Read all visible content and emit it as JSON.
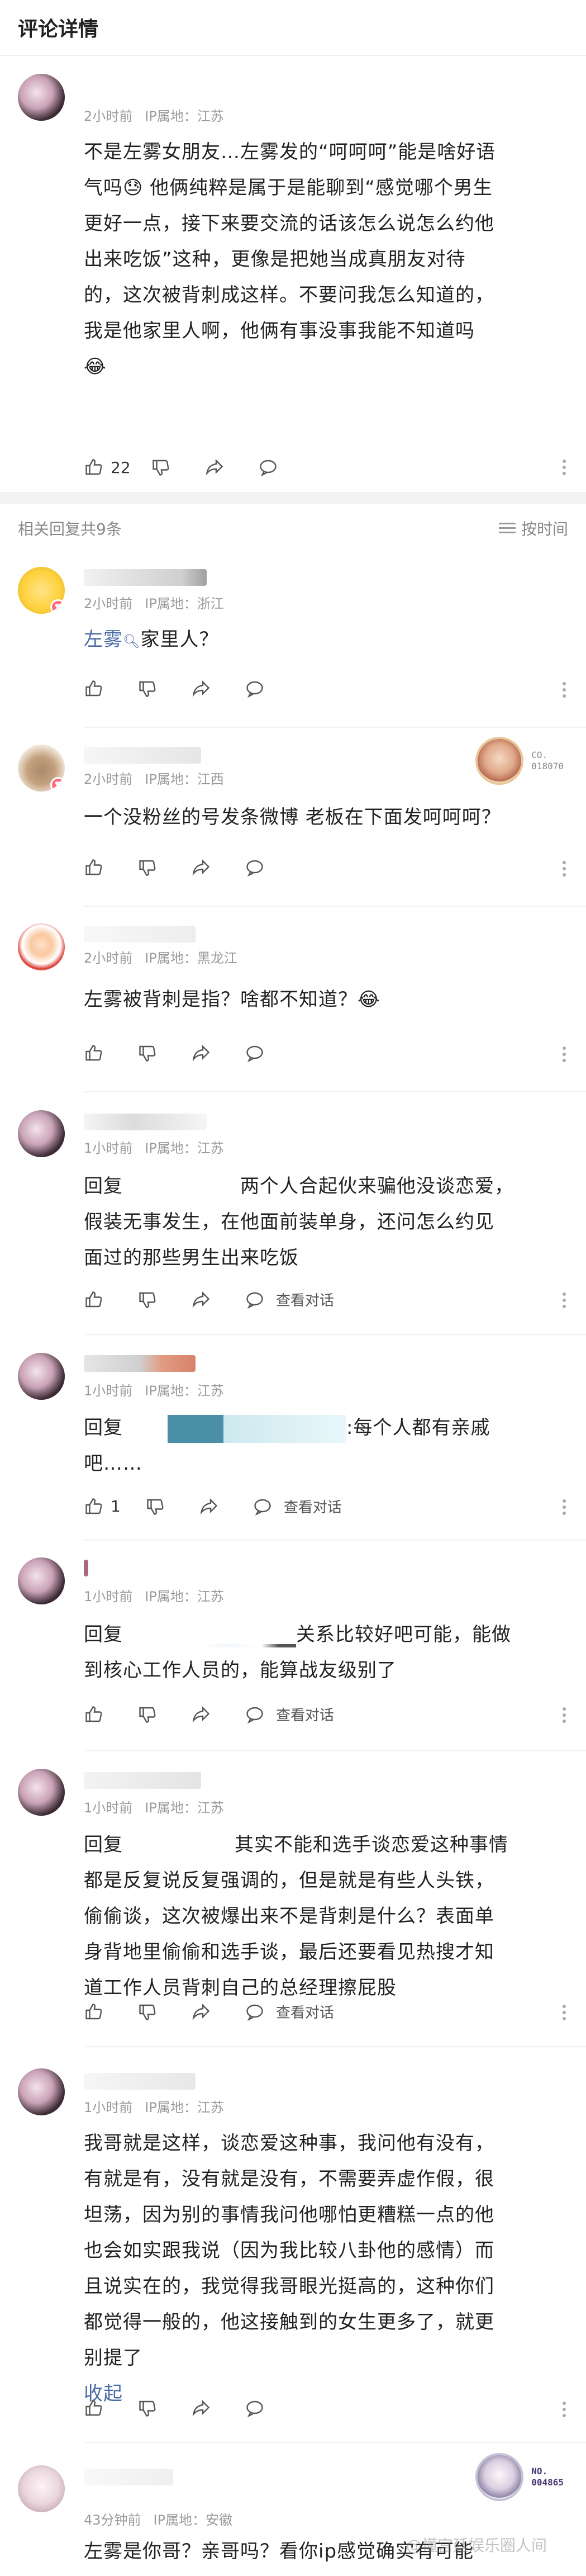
{
  "header": {
    "title": "评论详情"
  },
  "main_comment": {
    "time": "2小时前",
    "ip": "IP属地：江苏",
    "text_lines": [
      "不是左雾女朋友…左雾发的“呵呵呵”能是啥好语",
      "气吗😓 他俩纯粹是属于是能聊到“感觉哪个男生",
      "更好一点，接下来要交流的话该怎么说怎么约他",
      "出来吃饭”这种，更像是把她当成真朋友对待",
      "的，这次被背刺成这样。不要问我怎么知道的，",
      "我是他家里人啊，他俩有事没事我能不知道吗",
      "😂"
    ],
    "like_count": "22"
  },
  "replies_section": {
    "label": "相关回复共9条",
    "sort_label": "按时间"
  },
  "replies": [
    {
      "time": "2小时前",
      "ip": "IP属地：浙江",
      "link": "左雾",
      "text": "家里人？"
    },
    {
      "time": "2小时前",
      "ip": "IP属地：江西",
      "text": "一个没粉丝的号发条微博 老板在下面发呵呵呵？",
      "badge": "CO.\n018070"
    },
    {
      "time": "2小时前",
      "ip": "IP属地：黑龙江",
      "text": "左雾被背刺是指？啥都不知道？😂"
    },
    {
      "time": "1小时前",
      "ip": "IP属地：江苏",
      "reply_prefix": "回复",
      "text_lines": [
        "两个人合起伙来骗他没谈恋爱，",
        "假装无事发生，在他面前装单身，还问怎么约见",
        "面过的那些男生出来吃饭"
      ],
      "view_label": "查看对话"
    },
    {
      "time": "1小时前",
      "ip": "IP属地：江苏",
      "reply_prefix": "回复",
      "text_lines": [
        ":每个人都有亲戚",
        "吧……"
      ],
      "like_count": "1",
      "view_label": "查看对话"
    },
    {
      "time": "1小时前",
      "ip": "IP属地：江苏",
      "reply_prefix": "回复",
      "text_lines": [
        "关系比较好吧可能，能做",
        "到核心工作人员的，能算战友级别了"
      ],
      "view_label": "查看对话"
    },
    {
      "time": "1小时前",
      "ip": "IP属地：江苏",
      "reply_prefix": "回复",
      "text_lines": [
        "其实不能和选手谈恋爱这种事情",
        "都是反复说反复强调的，但是就是有些人头铁，",
        "偷偷谈，这次被爆出来不是背刺是什么？表面单",
        "身背地里偷偷和选手谈，最后还要看见热搜才知",
        "道工作人员背刺自己的总经理擦屁股"
      ],
      "view_label": "查看对话"
    },
    {
      "time": "1小时前",
      "ip": "IP属地：江苏",
      "text_lines": [
        "我哥就是这样，谈恋爱这种事，我问他有没有，",
        "有就是有，没有就是没有，不需要弄虚作假，很",
        "坦荡，因为别的事情我问他哪怕更糟糕一点的他",
        "也会如实跟我说（因为我比较八卦他的感情）而",
        "且说实在的，我觉得我哥眼光挺高的，这种你们",
        "都觉得一般的，他这接触到的女生更多了，就更",
        "别提了"
      ],
      "collapse_label": "收起"
    },
    {
      "time": "43分钟前",
      "ip": "IP属地：安徽",
      "text": "左雾是你哥？亲哥吗？看你ip感觉确实有可能",
      "badge": "NO.\n004865"
    }
  ],
  "watermark": "@懂宫廷娱乐圈人间"
}
